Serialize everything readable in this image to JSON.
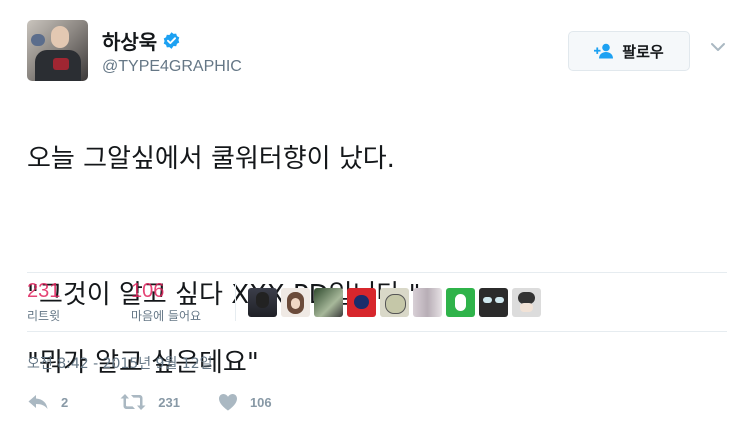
{
  "author": {
    "display_name": "하상욱",
    "handle": "@TYPE4GRAPHIC",
    "verified_icon": "verified-badge-icon"
  },
  "follow_button": {
    "label": "팔로우",
    "icon": "add-user-icon"
  },
  "more_menu": {
    "icon": "chevron-down-icon"
  },
  "tweet": {
    "lines": [
      "오늘 그알싶에서 쿨워터향이 났다.",
      "",
      "\"그것이 알고 싶다 XXX PD입니다.\"",
      "\"뭐가 알고 싶은데요\""
    ]
  },
  "stats": {
    "retweets": {
      "count": "231",
      "label": "리트윗"
    },
    "likes": {
      "count": "106",
      "label": "마음에 들어요"
    },
    "liker_avatars_count": 10
  },
  "timestamp": "오전 8:42 - 2015년 9월 12일",
  "actions": {
    "reply": {
      "icon": "reply-icon",
      "count": "2"
    },
    "retweet": {
      "icon": "retweet-icon",
      "count": "231"
    },
    "like": {
      "icon": "heart-icon",
      "count": "106"
    }
  },
  "colors": {
    "text": "#14171a",
    "secondary": "#657786",
    "verified": "#1da1f2",
    "like_count": "#e0245e",
    "action_icon": "#aab8c2"
  }
}
